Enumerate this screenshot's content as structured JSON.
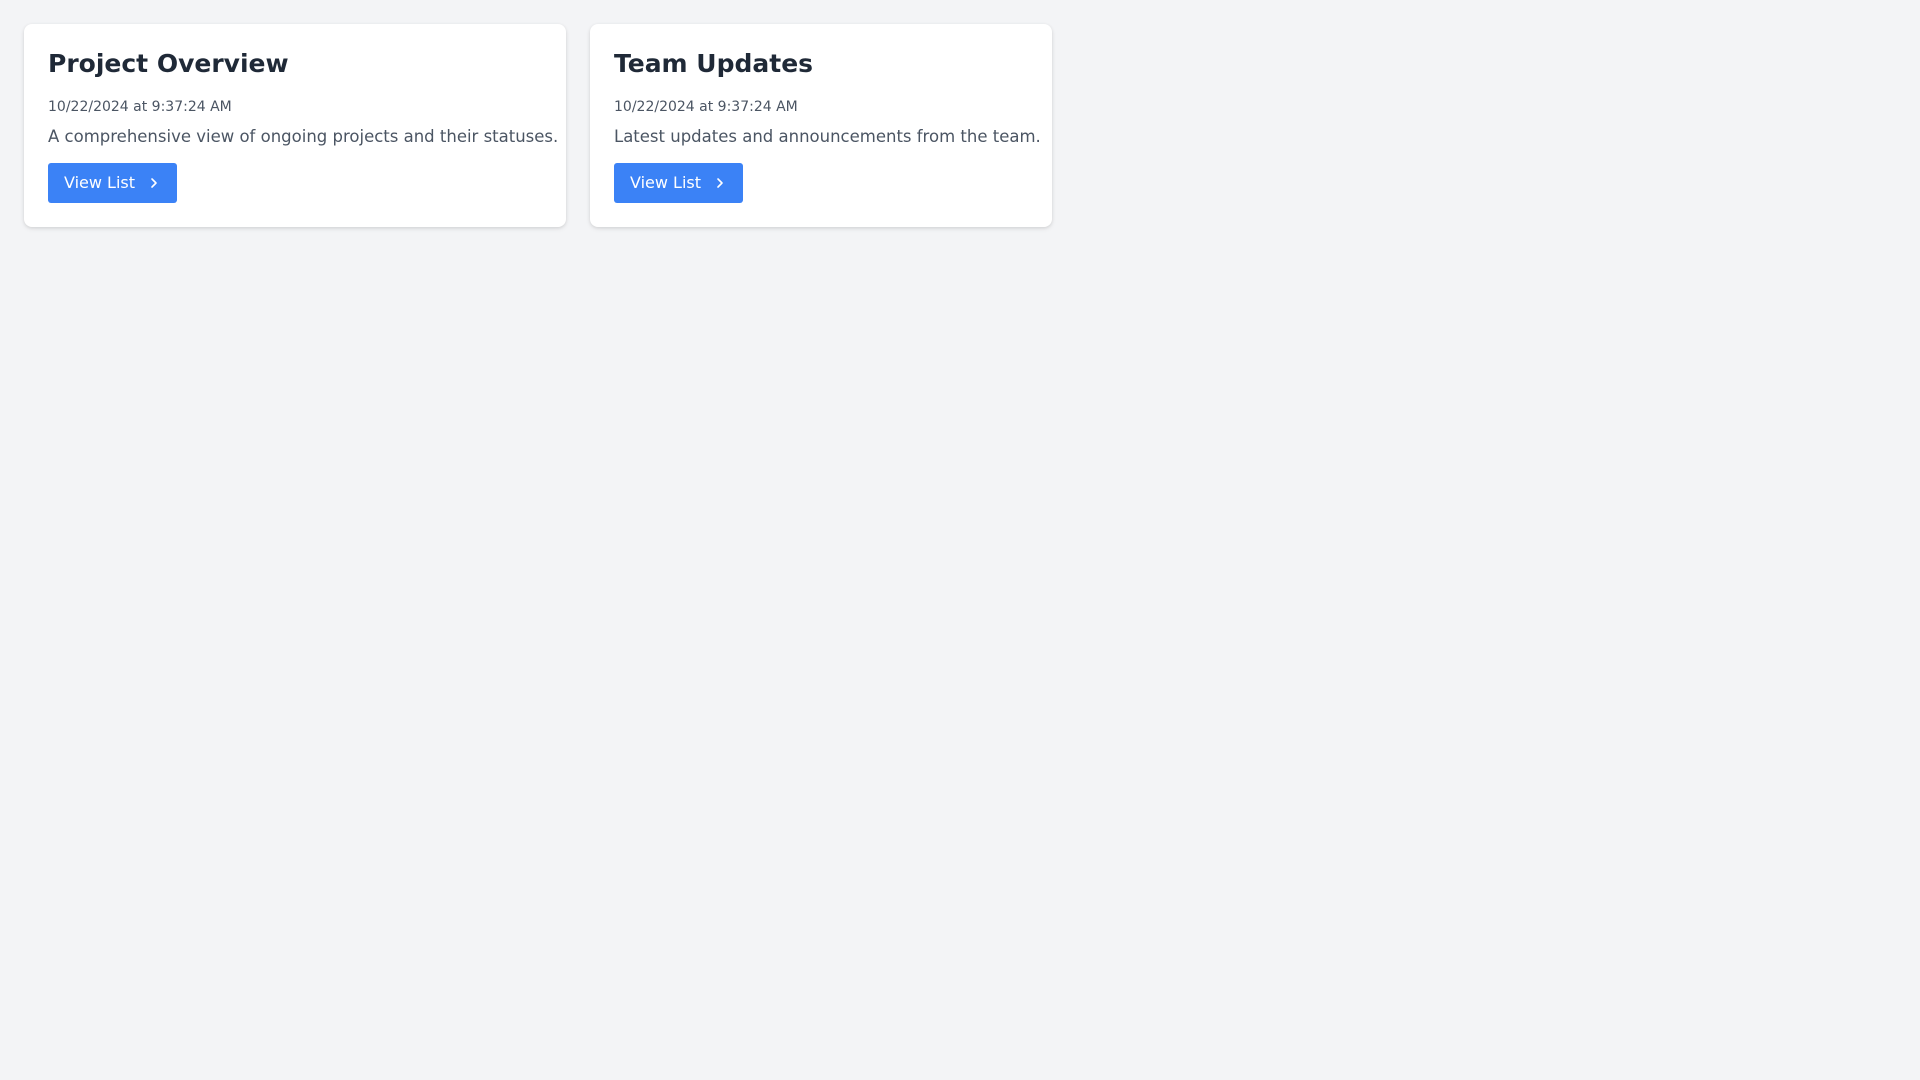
{
  "colors": {
    "background": "#f3f4f6",
    "card": "#ffffff",
    "title": "#1f2937",
    "muted_text": "#4b5563",
    "accent": "#3b82f6"
  },
  "cards": [
    {
      "title": "Project Overview",
      "date": "10/22/2024 at 9:37:24 AM",
      "description": "A comprehensive view of ongoing projects and their statuses.",
      "button_label": "View List",
      "button_icon": "chevron-right-icon"
    },
    {
      "title": "Team Updates",
      "date": "10/22/2024 at 9:37:24 AM",
      "description": "Latest updates and announcements from the team.",
      "button_label": "View List",
      "button_icon": "chevron-right-icon"
    }
  ]
}
